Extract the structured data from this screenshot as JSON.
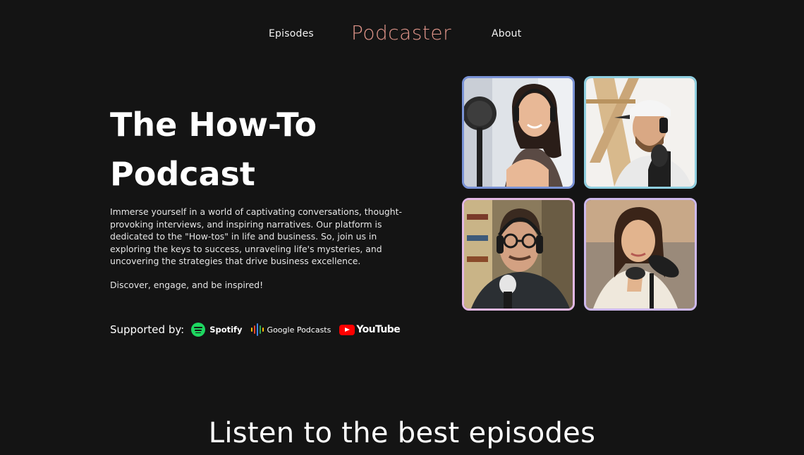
{
  "nav": {
    "episodes_label": "Episodes",
    "brand": "Podcaster",
    "about_label": "About"
  },
  "hero": {
    "title_line1": "The How-To",
    "title_line2": "Podcast",
    "description": "Immerse yourself in a world of captivating conversations, thought-provoking interviews, and inspiring narratives. Our platform is dedicated to the \"How-tos\" in life and business. So, join us in exploring the keys to success, unraveling life's mysteries, and uncovering the strategies that drive business excellence.",
    "tagline": "Discover, engage, and be inspired!",
    "supported_label": "Supported by:",
    "partners": [
      {
        "name": "Spotify",
        "icon": "spotify-icon"
      },
      {
        "name": "Google Podcasts",
        "icon": "google-podcasts-icon"
      },
      {
        "name": "YouTube",
        "icon": "youtube-icon"
      }
    ]
  },
  "hosts": [
    {
      "icon": "host-photo-woman-microphone",
      "border": "#7a93d6"
    },
    {
      "icon": "host-photo-man-cap",
      "border": "#8fcfe0"
    },
    {
      "icon": "host-photo-man-glasses",
      "border": "#e3b8e4"
    },
    {
      "icon": "host-photo-woman-headphones",
      "border": "#cdb9ec"
    }
  ],
  "colors": {
    "background": "#141414",
    "brand": "#e0958a",
    "spotify": "#1ed760",
    "youtube": "#ff0000"
  },
  "episodes_section": {
    "title": "Listen to the best episodes"
  }
}
